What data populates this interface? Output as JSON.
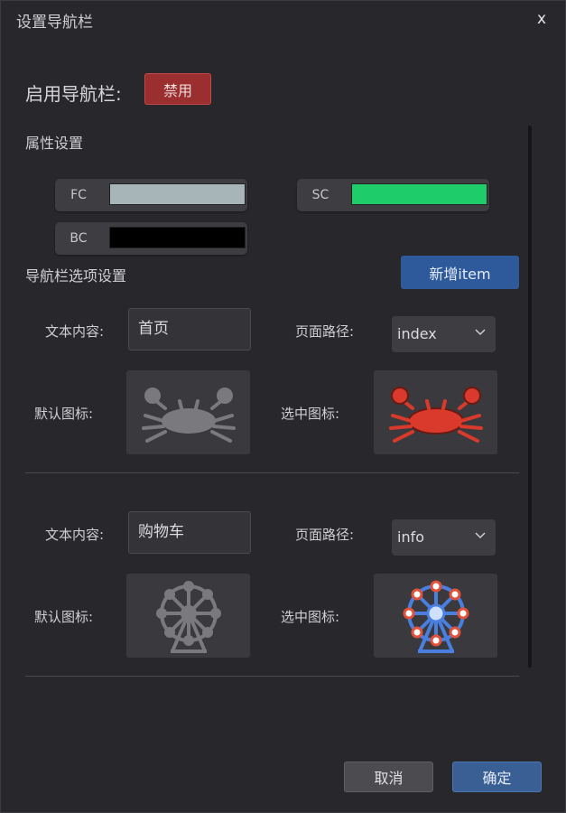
{
  "dialog": {
    "title": "设置导航栏",
    "close": "x"
  },
  "enable": {
    "label": "启用导航栏:",
    "button": "禁用"
  },
  "attributes": {
    "heading": "属性设置",
    "fc": {
      "label": "FC",
      "color": "#a7b5b8"
    },
    "sc": {
      "label": "SC",
      "color": "#1fcc6a"
    },
    "bc": {
      "label": "BC",
      "color": "#000000"
    }
  },
  "nav_items": {
    "heading": "导航栏选项设置",
    "add_button": "新增item",
    "text_label": "文本内容:",
    "path_label": "页面路径:",
    "default_icon_label": "默认图标:",
    "selected_icon_label": "选中图标:",
    "items": [
      {
        "text": "首页",
        "path": "index",
        "default_icon": "crab-icon-gray",
        "selected_icon": "crab-icon-red"
      },
      {
        "text": "购物车",
        "path": "info",
        "default_icon": "ferris-wheel-icon-gray",
        "selected_icon": "ferris-wheel-icon-blue"
      }
    ]
  },
  "footer": {
    "cancel": "取消",
    "confirm": "确定"
  }
}
